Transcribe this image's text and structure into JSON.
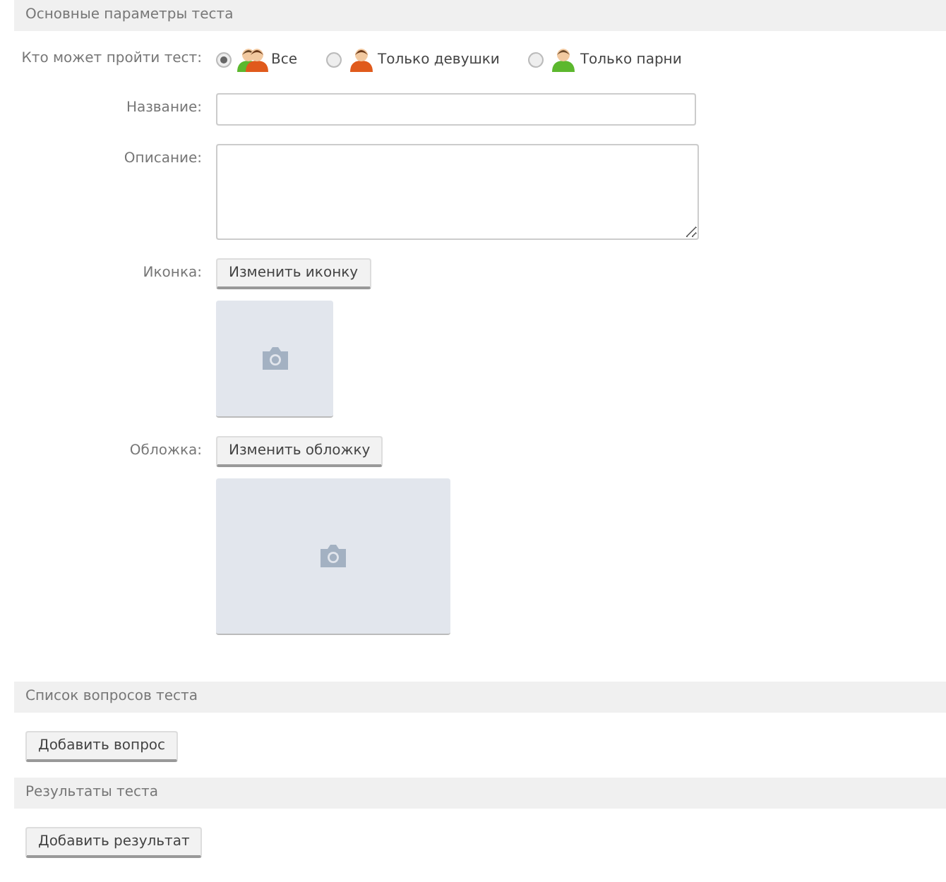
{
  "sections": [
    {
      "title": "Основные параметры теста",
      "kind": "params",
      "audience": {
        "label": "Кто может пройти тест:",
        "options": [
          {
            "label": "Все",
            "kind": "all",
            "selected": true
          },
          {
            "label": "Только девушки",
            "kind": "female",
            "selected": false
          },
          {
            "label": "Только парни",
            "kind": "male",
            "selected": false
          }
        ]
      },
      "fields": [
        {
          "label": "Название:",
          "kind": "input"
        },
        {
          "label": "Описание:",
          "kind": "textarea"
        },
        {
          "label": "Иконка:",
          "kind": "icon",
          "button": "Изменить иконку"
        },
        {
          "label": "Обложка:",
          "kind": "cover",
          "button": "Изменить обложку"
        }
      ]
    },
    {
      "title": "Список вопросов теста",
      "kind": "action",
      "button": "Добавить вопрос"
    },
    {
      "title": "Результаты теста",
      "kind": "action",
      "button": "Добавить результат"
    }
  ]
}
